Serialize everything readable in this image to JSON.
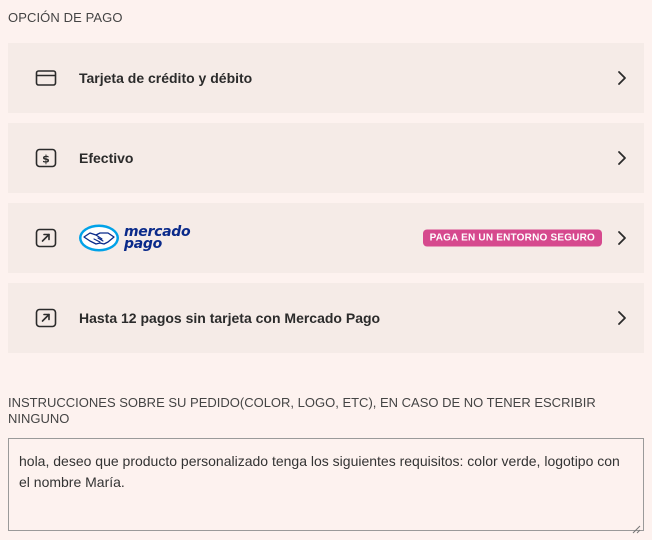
{
  "section_title": "OPCIÓN DE PAGO",
  "payment_options": [
    {
      "label": "Tarjeta de crédito y débito",
      "icon": "credit-card-icon"
    },
    {
      "label": "Efectivo",
      "icon": "cash-dollar-icon"
    },
    {
      "label": "",
      "icon": "external-link-icon",
      "logo_text_line1": "mercado",
      "logo_text_line2": "pago",
      "badge": "PAGA EN UN ENTORNO SEGURO"
    },
    {
      "label": "Hasta 12 pagos sin tarjeta con Mercado Pago",
      "icon": "external-link-icon"
    }
  ],
  "instructions": {
    "label": "INSTRUCCIONES SOBRE SU PEDIDO(COLOR, LOGO, ETC), EN CASO DE NO TENER ESCRIBIR NINGUNO",
    "value": "hola, deseo que producto personalizado tenga los siguientes requisitos: color verde, logotipo con el nombre María."
  },
  "colors": {
    "background": "#fdf2ef",
    "option_bg": "#f5ebe7",
    "badge_bg": "#d6498e",
    "mercadopago_blue": "#0a2a8a",
    "mercadopago_light": "#00a2e8"
  }
}
